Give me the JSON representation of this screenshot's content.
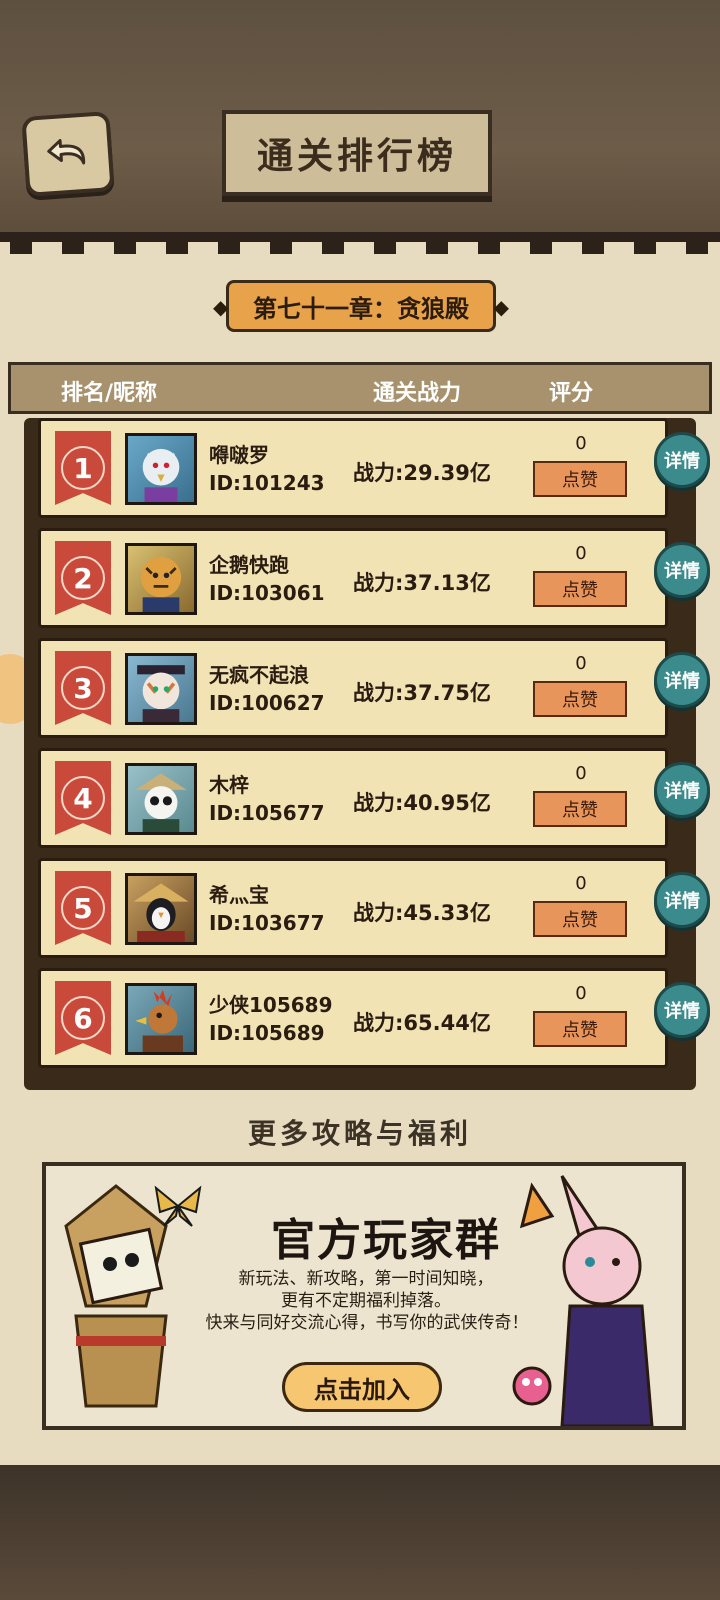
{
  "header": {
    "title": "通关排行榜",
    "back_icon": "back-arrow-icon"
  },
  "chapter": {
    "label": "第七十一章：贪狼殿"
  },
  "columns": {
    "rank_nickname": "排名/昵称",
    "power": "通关战力",
    "score": "评分"
  },
  "rows": [
    {
      "rank": "1",
      "nickname": "嘚啵罗",
      "id": "ID:101243",
      "power": "战力:29.39亿",
      "likes": "0",
      "like_label": "点赞",
      "detail_label": "详情"
    },
    {
      "rank": "2",
      "nickname": "企鹅快跑",
      "id": "ID:103061",
      "power": "战力:37.13亿",
      "likes": "0",
      "like_label": "点赞",
      "detail_label": "详情"
    },
    {
      "rank": "3",
      "nickname": "无疯不起浪",
      "id": "ID:100627",
      "power": "战力:37.75亿",
      "likes": "0",
      "like_label": "点赞",
      "detail_label": "详情"
    },
    {
      "rank": "4",
      "nickname": "木梓",
      "id": "ID:105677",
      "power": "战力:40.95亿",
      "likes": "0",
      "like_label": "点赞",
      "detail_label": "详情"
    },
    {
      "rank": "5",
      "nickname": "希灬宝",
      "id": "ID:103677",
      "power": "战力:45.33亿",
      "likes": "0",
      "like_label": "点赞",
      "detail_label": "详情"
    },
    {
      "rank": "6",
      "nickname": "少侠105689",
      "id": "ID:105689",
      "power": "战力:65.44亿",
      "likes": "0",
      "like_label": "点赞",
      "detail_label": "详情"
    }
  ],
  "more": {
    "title": "更多攻略与福利"
  },
  "banner": {
    "title": "官方玩家群",
    "line1": "新玩法、新攻略，第一时间知晓，",
    "line2": "更有不定期福利掉落。",
    "line3": "快来与同好交流心得，书写你的武侠传奇！",
    "button": "点击加入"
  }
}
